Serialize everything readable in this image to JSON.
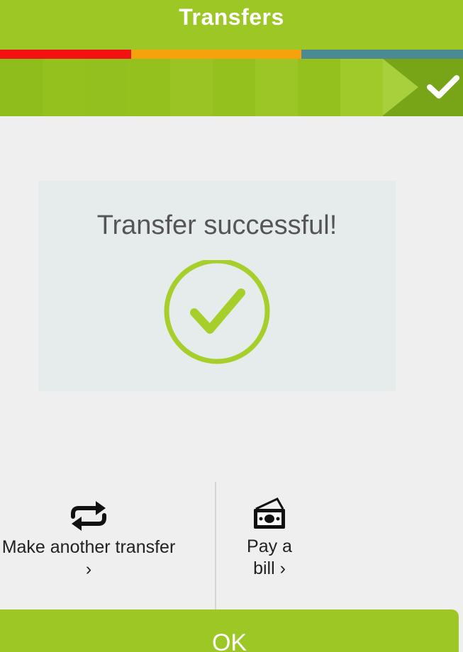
{
  "header": {
    "title": "Transfers"
  },
  "progress": {
    "segments": [
      {
        "color": "#f21212",
        "fraction": 0.283
      },
      {
        "color": "#f7a20d",
        "fraction": 0.368
      },
      {
        "color": "#4a8a90",
        "fraction": 0.349
      }
    ]
  },
  "steps": {
    "completed_icon": "check-icon"
  },
  "card": {
    "message": "Transfer successful!",
    "icon": "success-check-circle-icon"
  },
  "actions": {
    "transfer": {
      "label": "Make another transfer",
      "chevron": "›",
      "icon": "repeat-arrows-icon"
    },
    "bill": {
      "label_line1": "Pay a",
      "label_line2": "bill",
      "chevron": "›",
      "icon": "money-bill-icon"
    }
  },
  "ok_button": {
    "label": "OK"
  },
  "colors": {
    "brand_green": "#9cc725",
    "check_green": "#a6cf2b",
    "card_bg": "#e6ebeb"
  }
}
